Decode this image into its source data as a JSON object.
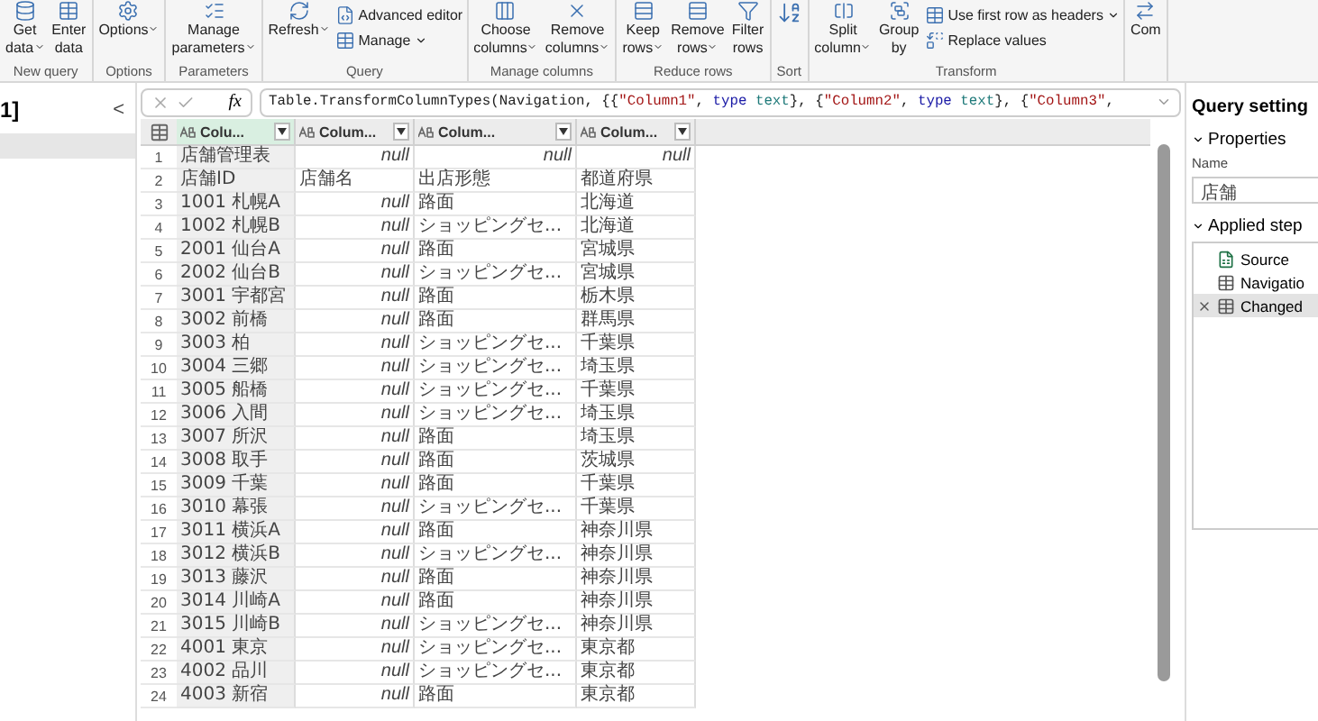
{
  "ribbon": [
    {
      "label": "New query",
      "items": [
        {
          "kind": "large",
          "lines": [
            "Get",
            "data"
          ],
          "dropdown": true
        },
        {
          "kind": "large",
          "lines": [
            "Enter",
            "data"
          ],
          "dropdown": false
        }
      ]
    },
    {
      "label": "Options",
      "items": [
        {
          "kind": "large",
          "lines": [
            "Options"
          ],
          "dropdown": true
        }
      ]
    },
    {
      "label": "Parameters",
      "items": [
        {
          "kind": "large",
          "lines": [
            "Manage",
            "parameters"
          ],
          "dropdown": true
        }
      ]
    },
    {
      "label": "Query",
      "items": [
        {
          "kind": "large",
          "lines": [
            "Refresh"
          ],
          "dropdown": true
        },
        {
          "kind": "small",
          "lines": [
            "Advanced editor"
          ],
          "dropdown": false
        },
        {
          "kind": "small",
          "lines": [
            "Manage"
          ],
          "dropdown": true
        }
      ]
    },
    {
      "label": "Manage columns",
      "items": [
        {
          "kind": "large",
          "lines": [
            "Choose",
            "columns"
          ],
          "dropdown": true
        },
        {
          "kind": "large",
          "lines": [
            "Remove",
            "columns"
          ],
          "dropdown": true
        }
      ]
    },
    {
      "label": "Reduce rows",
      "items": [
        {
          "kind": "large",
          "lines": [
            "Keep",
            "rows"
          ],
          "dropdown": true
        },
        {
          "kind": "large",
          "lines": [
            "Remove",
            "rows"
          ],
          "dropdown": true
        },
        {
          "kind": "large",
          "lines": [
            "Filter",
            "rows"
          ],
          "dropdown": false
        }
      ]
    },
    {
      "label": "Sort",
      "items": [
        {
          "kind": "icon",
          "dropdown": false
        }
      ]
    },
    {
      "label": "Transform",
      "items": [
        {
          "kind": "large",
          "lines": [
            "Split",
            "column"
          ],
          "dropdown": true
        },
        {
          "kind": "large",
          "lines": [
            "Group",
            "by"
          ],
          "dropdown": false
        },
        {
          "kind": "small",
          "lines": [
            "Use first row as headers"
          ],
          "dropdown": true
        },
        {
          "kind": "small",
          "lines": [
            "Replace values"
          ],
          "dropdown": false
        }
      ]
    },
    {
      "items": [
        {
          "kind": "large",
          "lines": [
            "Com"
          ],
          "dropdown": false
        }
      ]
    }
  ],
  "queries_panel": {
    "title": "1]",
    "collapse": "<"
  },
  "formula": {
    "fx_label": "fx",
    "tokens": [
      {
        "kind": "plain",
        "text": "Table.TransformColumnTypes(Navigation, {{"
      },
      {
        "kind": "string",
        "text": "\"Column1\""
      },
      {
        "kind": "plain",
        "text": ", "
      },
      {
        "kind": "keyword",
        "text": "type "
      },
      {
        "kind": "type",
        "text": "text"
      },
      {
        "kind": "plain",
        "text": "}, {"
      },
      {
        "kind": "string",
        "text": "\"Column2\""
      },
      {
        "kind": "plain",
        "text": ", "
      },
      {
        "kind": "keyword",
        "text": "type "
      },
      {
        "kind": "type",
        "text": "text"
      },
      {
        "kind": "plain",
        "text": "}, {"
      },
      {
        "kind": "string",
        "text": "\"Column3\""
      },
      {
        "kind": "plain",
        "text": ","
      }
    ]
  },
  "table": {
    "columns": [
      {
        "label": "Colu...",
        "selected": true
      },
      {
        "label": "Colum...",
        "selected": false
      },
      {
        "label": "Colum...",
        "selected": false
      },
      {
        "label": "Colum...",
        "selected": false
      }
    ],
    "rows": [
      {
        "num": "1",
        "cells": [
          {
            "kind": "text",
            "value": "店舗管理表"
          },
          {
            "kind": "null",
            "value": "null"
          },
          {
            "kind": "null",
            "value": "null"
          },
          {
            "kind": "null",
            "value": "null"
          }
        ]
      },
      {
        "num": "2",
        "cells": [
          {
            "kind": "text",
            "value": "店舗ID"
          },
          {
            "kind": "text",
            "value": "店舗名"
          },
          {
            "kind": "text",
            "value": "出店形態"
          },
          {
            "kind": "text",
            "value": "都道府県"
          }
        ]
      },
      {
        "num": "3",
        "cells": [
          {
            "kind": "text",
            "value": "1001 札幌A"
          },
          {
            "kind": "null",
            "value": "null"
          },
          {
            "kind": "text",
            "value": "路面"
          },
          {
            "kind": "text",
            "value": "北海道"
          }
        ]
      },
      {
        "num": "4",
        "cells": [
          {
            "kind": "text",
            "value": "1002 札幌B"
          },
          {
            "kind": "null",
            "value": "null"
          },
          {
            "kind": "text",
            "value": "ショッピングセ..."
          },
          {
            "kind": "text",
            "value": "北海道"
          }
        ]
      },
      {
        "num": "5",
        "cells": [
          {
            "kind": "text",
            "value": "2001 仙台A"
          },
          {
            "kind": "null",
            "value": "null"
          },
          {
            "kind": "text",
            "value": "路面"
          },
          {
            "kind": "text",
            "value": "宮城県"
          }
        ]
      },
      {
        "num": "6",
        "cells": [
          {
            "kind": "text",
            "value": "2002 仙台B"
          },
          {
            "kind": "null",
            "value": "null"
          },
          {
            "kind": "text",
            "value": "ショッピングセ..."
          },
          {
            "kind": "text",
            "value": "宮城県"
          }
        ]
      },
      {
        "num": "7",
        "cells": [
          {
            "kind": "text",
            "value": "3001 宇都宮"
          },
          {
            "kind": "null",
            "value": "null"
          },
          {
            "kind": "text",
            "value": "路面"
          },
          {
            "kind": "text",
            "value": "栃木県"
          }
        ]
      },
      {
        "num": "8",
        "cells": [
          {
            "kind": "text",
            "value": "3002 前橋"
          },
          {
            "kind": "null",
            "value": "null"
          },
          {
            "kind": "text",
            "value": "路面"
          },
          {
            "kind": "text",
            "value": "群馬県"
          }
        ]
      },
      {
        "num": "9",
        "cells": [
          {
            "kind": "text",
            "value": "3003 柏"
          },
          {
            "kind": "null",
            "value": "null"
          },
          {
            "kind": "text",
            "value": "ショッピングセ..."
          },
          {
            "kind": "text",
            "value": "千葉県"
          }
        ]
      },
      {
        "num": "10",
        "cells": [
          {
            "kind": "text",
            "value": "3004 三郷"
          },
          {
            "kind": "null",
            "value": "null"
          },
          {
            "kind": "text",
            "value": "ショッピングセ..."
          },
          {
            "kind": "text",
            "value": "埼玉県"
          }
        ]
      },
      {
        "num": "11",
        "cells": [
          {
            "kind": "text",
            "value": "3005 船橋"
          },
          {
            "kind": "null",
            "value": "null"
          },
          {
            "kind": "text",
            "value": "ショッピングセ..."
          },
          {
            "kind": "text",
            "value": "千葉県"
          }
        ]
      },
      {
        "num": "12",
        "cells": [
          {
            "kind": "text",
            "value": "3006 入間"
          },
          {
            "kind": "null",
            "value": "null"
          },
          {
            "kind": "text",
            "value": "ショッピングセ..."
          },
          {
            "kind": "text",
            "value": "埼玉県"
          }
        ]
      },
      {
        "num": "13",
        "cells": [
          {
            "kind": "text",
            "value": "3007 所沢"
          },
          {
            "kind": "null",
            "value": "null"
          },
          {
            "kind": "text",
            "value": "路面"
          },
          {
            "kind": "text",
            "value": "埼玉県"
          }
        ]
      },
      {
        "num": "14",
        "cells": [
          {
            "kind": "text",
            "value": "3008 取手"
          },
          {
            "kind": "null",
            "value": "null"
          },
          {
            "kind": "text",
            "value": "路面"
          },
          {
            "kind": "text",
            "value": "茨城県"
          }
        ]
      },
      {
        "num": "15",
        "cells": [
          {
            "kind": "text",
            "value": "3009 千葉"
          },
          {
            "kind": "null",
            "value": "null"
          },
          {
            "kind": "text",
            "value": "路面"
          },
          {
            "kind": "text",
            "value": "千葉県"
          }
        ]
      },
      {
        "num": "16",
        "cells": [
          {
            "kind": "text",
            "value": "3010 幕張"
          },
          {
            "kind": "null",
            "value": "null"
          },
          {
            "kind": "text",
            "value": "ショッピングセ..."
          },
          {
            "kind": "text",
            "value": "千葉県"
          }
        ]
      },
      {
        "num": "17",
        "cells": [
          {
            "kind": "text",
            "value": "3011 横浜A"
          },
          {
            "kind": "null",
            "value": "null"
          },
          {
            "kind": "text",
            "value": "路面"
          },
          {
            "kind": "text",
            "value": "神奈川県"
          }
        ]
      },
      {
        "num": "18",
        "cells": [
          {
            "kind": "text",
            "value": "3012 横浜B"
          },
          {
            "kind": "null",
            "value": "null"
          },
          {
            "kind": "text",
            "value": "ショッピングセ..."
          },
          {
            "kind": "text",
            "value": "神奈川県"
          }
        ]
      },
      {
        "num": "19",
        "cells": [
          {
            "kind": "text",
            "value": "3013 藤沢"
          },
          {
            "kind": "null",
            "value": "null"
          },
          {
            "kind": "text",
            "value": "路面"
          },
          {
            "kind": "text",
            "value": "神奈川県"
          }
        ]
      },
      {
        "num": "20",
        "cells": [
          {
            "kind": "text",
            "value": "3014 川崎A"
          },
          {
            "kind": "null",
            "value": "null"
          },
          {
            "kind": "text",
            "value": "路面"
          },
          {
            "kind": "text",
            "value": "神奈川県"
          }
        ]
      },
      {
        "num": "21",
        "cells": [
          {
            "kind": "text",
            "value": "3015 川崎B"
          },
          {
            "kind": "null",
            "value": "null"
          },
          {
            "kind": "text",
            "value": "ショッピングセ..."
          },
          {
            "kind": "text",
            "value": "神奈川県"
          }
        ]
      },
      {
        "num": "22",
        "cells": [
          {
            "kind": "text",
            "value": "4001 東京"
          },
          {
            "kind": "null",
            "value": "null"
          },
          {
            "kind": "text",
            "value": "ショッピングセ..."
          },
          {
            "kind": "text",
            "value": "東京都"
          }
        ]
      },
      {
        "num": "23",
        "cells": [
          {
            "kind": "text",
            "value": "4002 品川"
          },
          {
            "kind": "null",
            "value": "null"
          },
          {
            "kind": "text",
            "value": "ショッピングセ..."
          },
          {
            "kind": "text",
            "value": "東京都"
          }
        ]
      },
      {
        "num": "24",
        "cells": [
          {
            "kind": "text",
            "value": "4003 新宿"
          },
          {
            "kind": "null",
            "value": "null"
          },
          {
            "kind": "text",
            "value": "路面"
          },
          {
            "kind": "text",
            "value": "東京都"
          }
        ]
      }
    ]
  },
  "query_settings": {
    "title": "Query setting",
    "properties": {
      "heading": "Properties",
      "expanded": true,
      "name_label": "Name",
      "name_value": "店舗"
    },
    "applied_steps": {
      "heading": "Applied step",
      "expanded": true,
      "steps": [
        {
          "label": "Source",
          "selected": false
        },
        {
          "label": "Navigatio",
          "selected": false
        },
        {
          "label": "Changed",
          "selected": true
        }
      ]
    }
  }
}
